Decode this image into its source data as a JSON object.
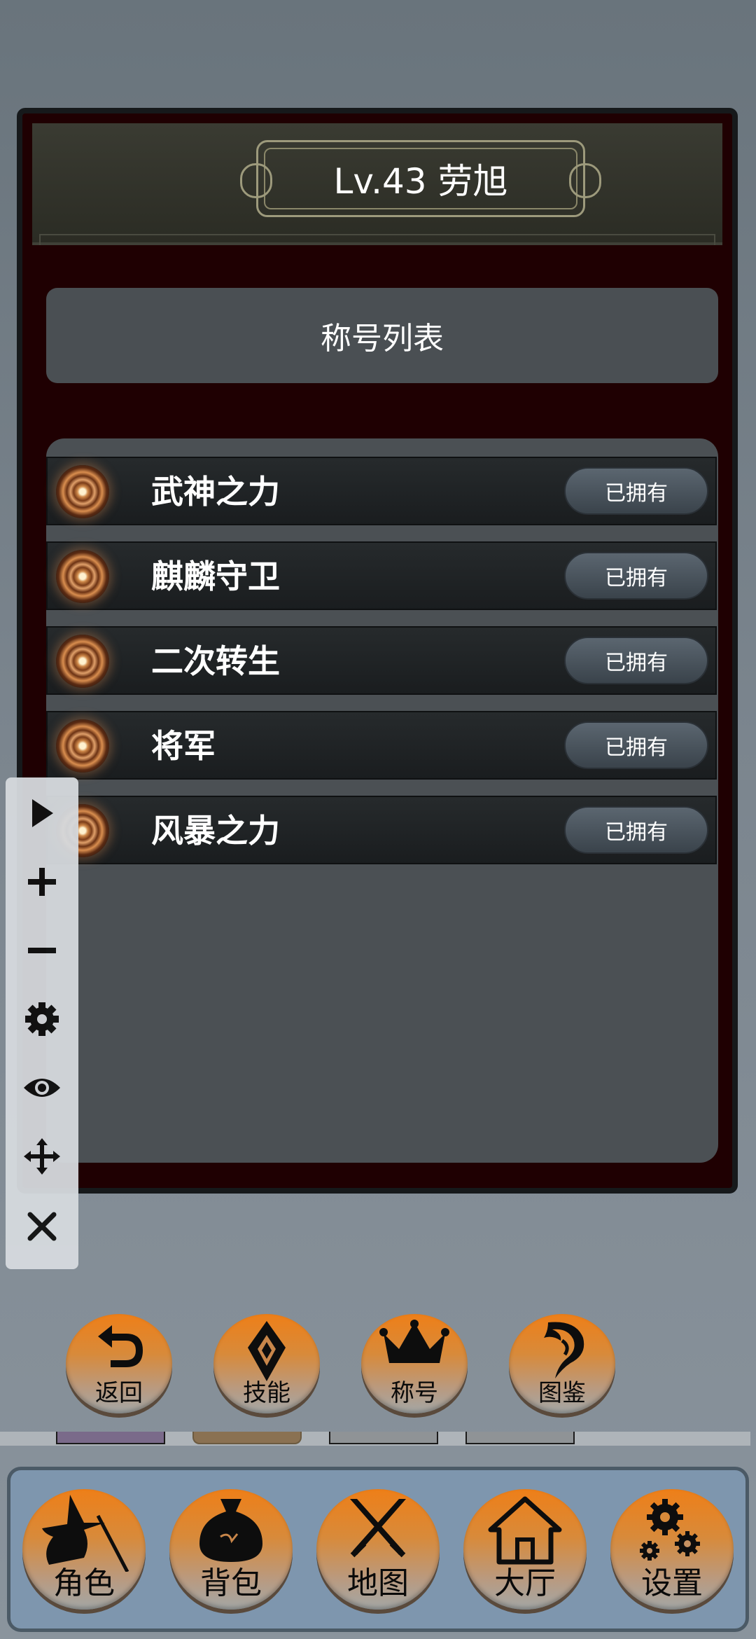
{
  "dialog": {
    "title": "Lv.43 劳旭",
    "list_title": "称号列表",
    "titles": [
      {
        "name": "武神之力",
        "status": "已拥有"
      },
      {
        "name": "麒麟守卫",
        "status": "已拥有"
      },
      {
        "name": "二次转生",
        "status": "已拥有"
      },
      {
        "name": "将军",
        "status": "已拥有"
      },
      {
        "name": "风暴之力",
        "status": "已拥有"
      }
    ]
  },
  "float_toolbar": {
    "items": [
      "play-icon",
      "plus-icon",
      "minus-icon",
      "gear-icon",
      "eye-icon",
      "move-icon",
      "close-icon"
    ]
  },
  "action_buttons": [
    {
      "label": "返回",
      "icon": "return-arrow-icon"
    },
    {
      "label": "技能",
      "icon": "skill-emblem-icon"
    },
    {
      "label": "称号",
      "icon": "crown-icon"
    },
    {
      "label": "图鉴",
      "icon": "dragon-icon"
    }
  ],
  "bottom_nav": [
    {
      "label": "角色",
      "icon": "wizard-icon"
    },
    {
      "label": "背包",
      "icon": "bag-icon"
    },
    {
      "label": "地图",
      "icon": "crossed-swords-icon"
    },
    {
      "label": "大厅",
      "icon": "home-icon"
    },
    {
      "label": "设置",
      "icon": "gears-icon"
    }
  ],
  "colors": {
    "dialog_bg": "#1f0002",
    "panel_bg": "#4b5054",
    "button_orange": "#ee7f18",
    "nav_panel": "#7e96ae"
  }
}
